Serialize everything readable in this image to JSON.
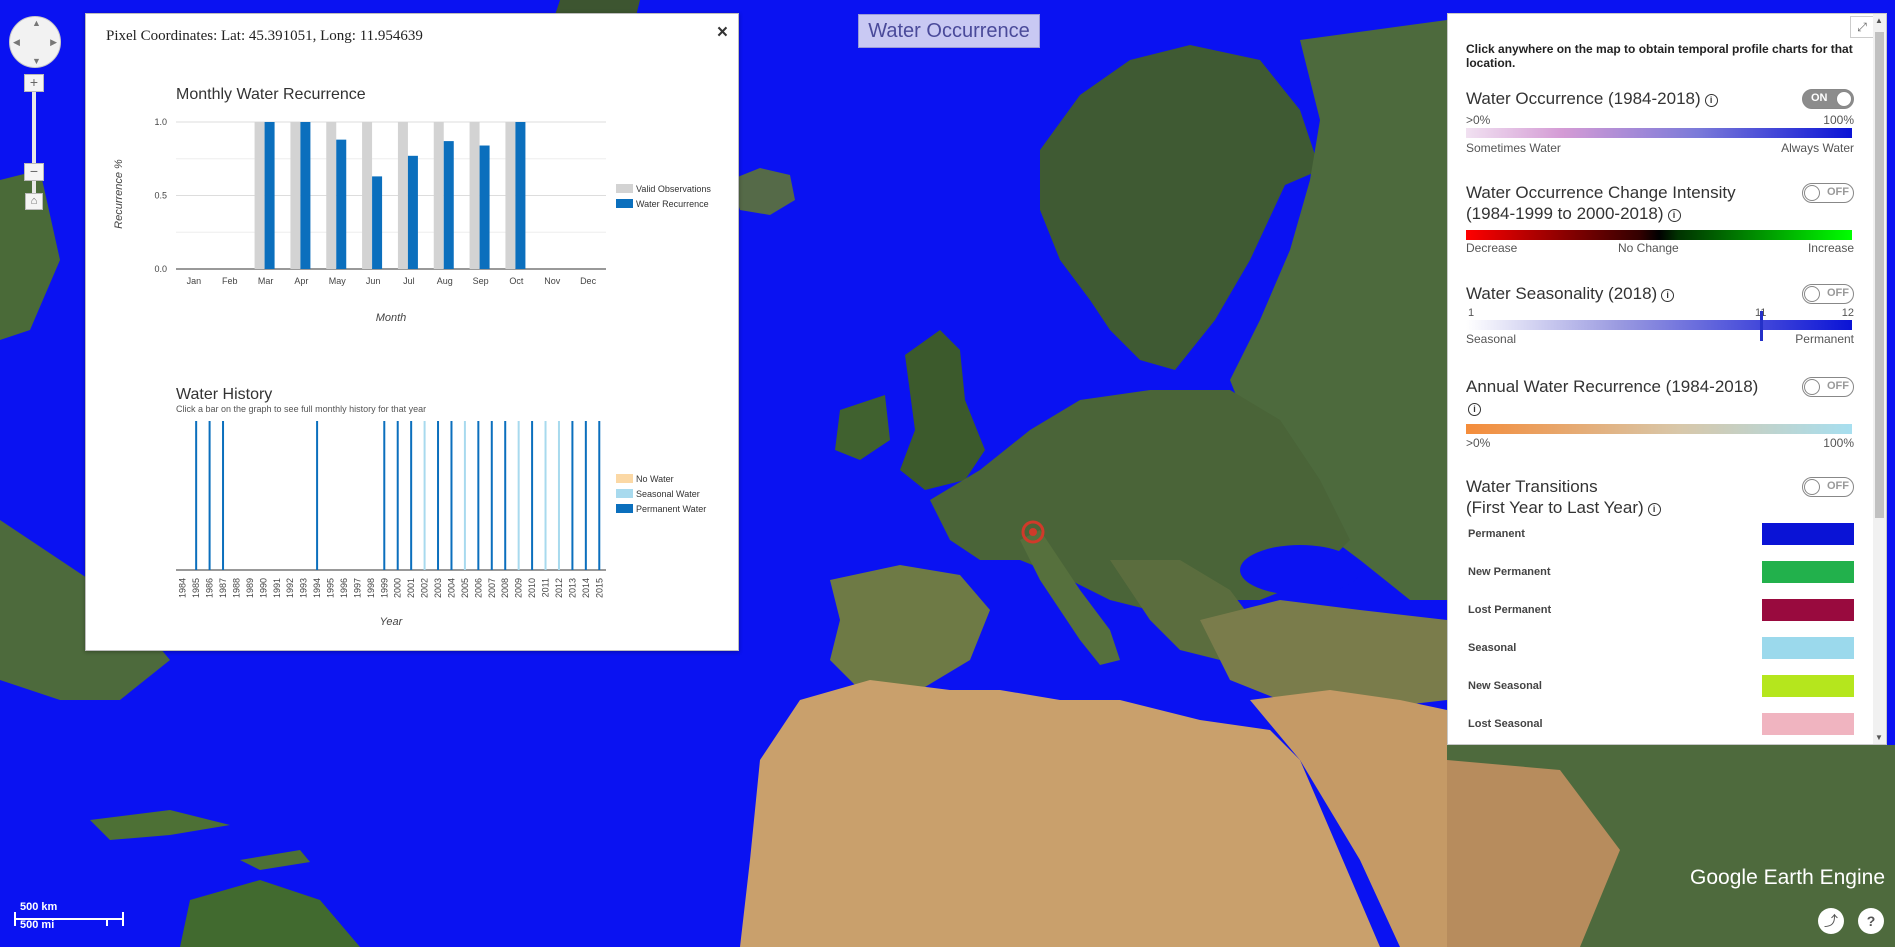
{
  "app": {
    "title": "Water Occurrence",
    "logo_text": "Google Earth Engine"
  },
  "map": {
    "scale_km": "500 km",
    "scale_mi": "500 mi",
    "nav": {
      "zoom_in": "+",
      "zoom_out": "−",
      "home": "⌂"
    }
  },
  "popup": {
    "coords": "Pixel Coordinates: Lat: 45.391051, Long: 11.954639",
    "close": "×"
  },
  "chart_data": [
    {
      "type": "bar",
      "title": "Monthly Water Recurrence",
      "xlabel": "Month",
      "ylabel": "Recurrence %",
      "ylim": [
        0,
        1.0
      ],
      "yticks": [
        "0.0",
        "0.5",
        "1.0"
      ],
      "categories": [
        "Jan",
        "Feb",
        "Mar",
        "Apr",
        "May",
        "Jun",
        "Jul",
        "Aug",
        "Sep",
        "Oct",
        "Nov",
        "Dec"
      ],
      "series": [
        {
          "name": "Valid Observations",
          "color": "#d3d3d3",
          "values": [
            0,
            0,
            1.0,
            1.0,
            1.0,
            1.0,
            1.0,
            1.0,
            1.0,
            1.0,
            0,
            0
          ]
        },
        {
          "name": "Water Recurrence",
          "color": "#0b6fbd",
          "values": [
            0,
            0,
            1.0,
            1.0,
            0.88,
            0.63,
            0.77,
            0.87,
            0.84,
            1.0,
            0,
            0
          ]
        }
      ],
      "legend": "right"
    },
    {
      "type": "bar",
      "title": "Water History",
      "subtitle": "Click a bar on the graph to see full monthly history for that year",
      "xlabel": "Year",
      "categories": [
        "1984",
        "1985",
        "1986",
        "1987",
        "1988",
        "1989",
        "1990",
        "1991",
        "1992",
        "1993",
        "1994",
        "1995",
        "1996",
        "1997",
        "1998",
        "1999",
        "2000",
        "2001",
        "2002",
        "2003",
        "2004",
        "2005",
        "2006",
        "2007",
        "2008",
        "2009",
        "2010",
        "2011",
        "2012",
        "2013",
        "2014",
        "2015"
      ],
      "series": [
        {
          "name": "No Water",
          "color": "#fbd8a5"
        },
        {
          "name": "Seasonal Water",
          "color": "#a8daee"
        },
        {
          "name": "Permanent Water",
          "color": "#0b6fbd"
        }
      ],
      "values": [
        "none",
        "permanent",
        "permanent",
        "permanent",
        "none",
        "none",
        "none",
        "none",
        "none",
        "none",
        "permanent",
        "none",
        "none",
        "none",
        "none",
        "permanent",
        "permanent",
        "permanent",
        "seasonal",
        "permanent",
        "permanent",
        "seasonal",
        "permanent",
        "permanent",
        "permanent",
        "seasonal",
        "permanent",
        "seasonal",
        "seasonal",
        "permanent",
        "permanent",
        "permanent"
      ],
      "legend": "right"
    }
  ],
  "panel": {
    "intro": "Click anywhere on the map to obtain temporal profile charts for that location.",
    "expand": "⤢",
    "layers": [
      {
        "name": "Water Occurrence (1984-2018)",
        "toggle": "ON",
        "min_label": ">0%",
        "max_label": "100%",
        "left_label": "Sometimes Water",
        "right_label": "Always Water"
      },
      {
        "name_line1": "Water Occurrence Change Intensity",
        "name_line2": "(1984-1999 to 2000-2018)",
        "toggle": "OFF",
        "left_label": "Decrease",
        "mid_label": "No Change",
        "right_label": "Increase"
      },
      {
        "name": "Water Seasonality (2018)",
        "toggle": "OFF",
        "min_label": "1",
        "mark_label": "11",
        "max_label": "12",
        "left_label": "Seasonal",
        "right_label": "Permanent"
      },
      {
        "name": "Annual Water Recurrence (1984-2018)",
        "toggle": "OFF",
        "min_label": ">0%",
        "max_label": "100%"
      },
      {
        "name_line1": "Water Transitions",
        "name_line2": "(First Year to Last Year)",
        "toggle": "OFF"
      }
    ],
    "transitions": [
      {
        "label": "Permanent",
        "color": "#0a13d6"
      },
      {
        "label": "New Permanent",
        "color": "#22b14c"
      },
      {
        "label": "Lost Permanent",
        "color": "#990a3e"
      },
      {
        "label": "Seasonal",
        "color": "#9bd9ec"
      },
      {
        "label": "New Seasonal",
        "color": "#b5e61d"
      },
      {
        "label": "Lost Seasonal",
        "color": "#f0b4c0"
      }
    ]
  },
  "footer": {
    "share": "⤴",
    "help": "?"
  }
}
